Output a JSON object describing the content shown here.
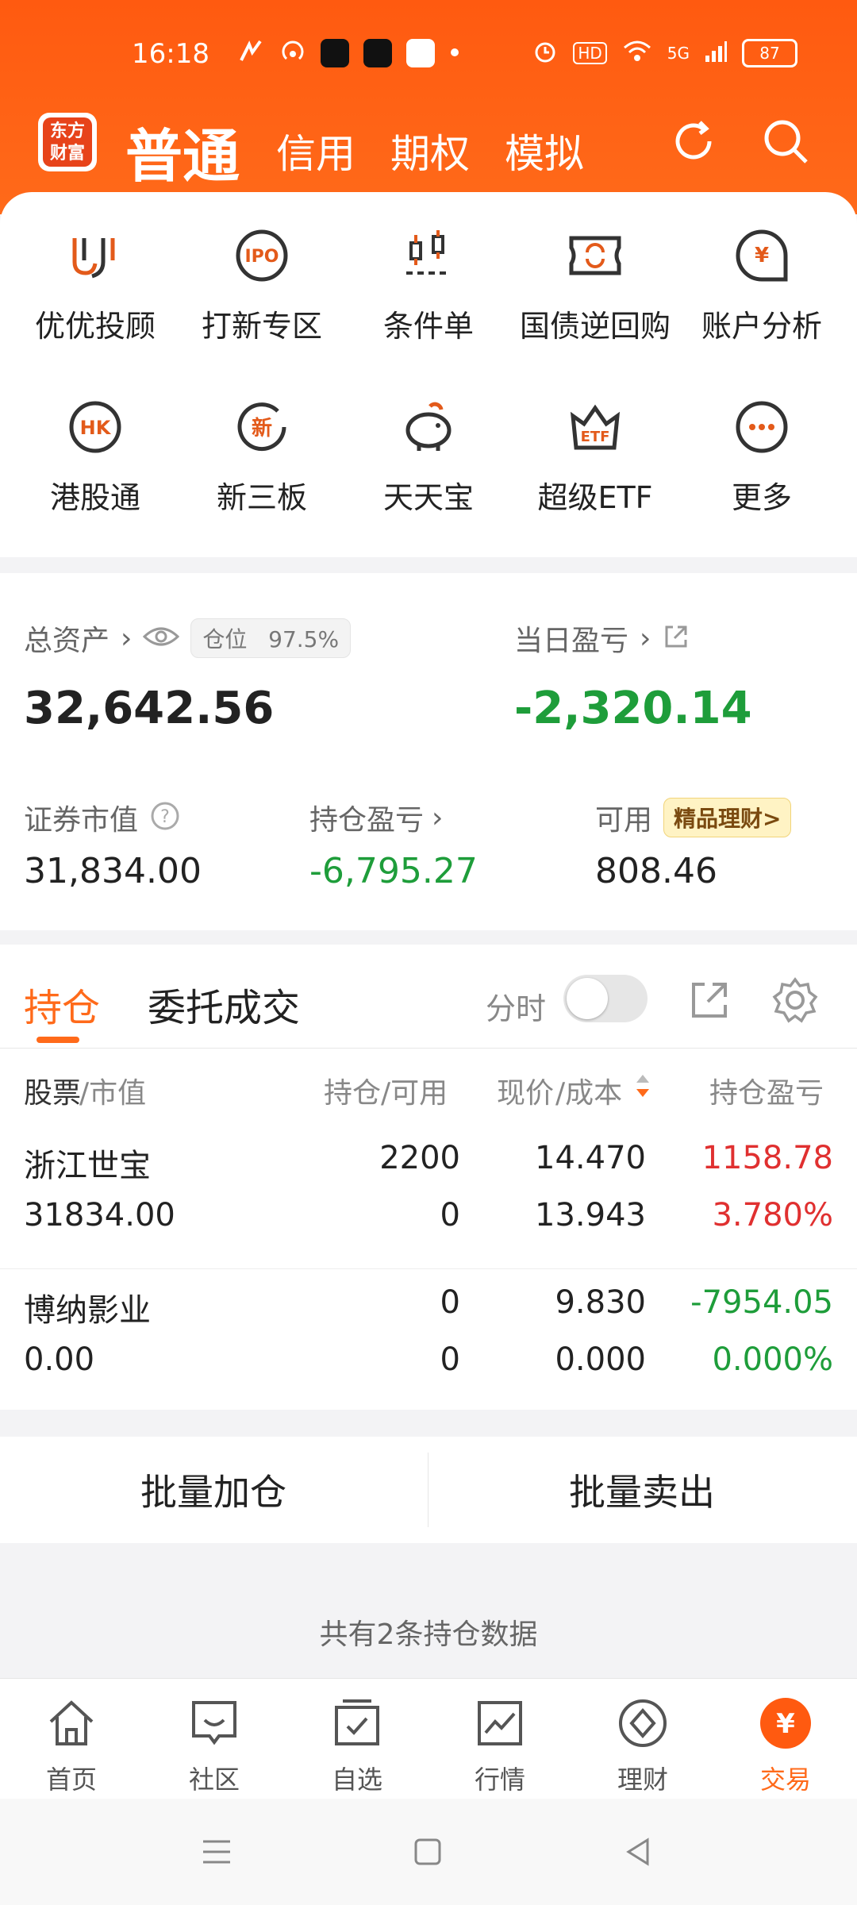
{
  "status_bar": {
    "time": "16:18",
    "hd_label": "HD",
    "network": "5G",
    "battery": "87"
  },
  "header": {
    "logo_text": "东方\n财富",
    "tabs": [
      "普通",
      "信用",
      "期权",
      "模拟"
    ],
    "active_tab": "普通"
  },
  "quick_menu": [
    {
      "label": "优优投顾",
      "icon": "uu-advisor-icon"
    },
    {
      "label": "打新专区",
      "icon": "ipo-icon"
    },
    {
      "label": "条件单",
      "icon": "condition-order-icon"
    },
    {
      "label": "国债逆回购",
      "icon": "reverse-repo-icon"
    },
    {
      "label": "账户分析",
      "icon": "account-analysis-icon"
    },
    {
      "label": "港股通",
      "icon": "hk-connect-icon"
    },
    {
      "label": "新三板",
      "icon": "neeq-icon"
    },
    {
      "label": "天天宝",
      "icon": "piggy-bank-icon"
    },
    {
      "label": "超级ETF",
      "icon": "etf-icon"
    },
    {
      "label": "更多",
      "icon": "more-icon"
    }
  ],
  "assets": {
    "total_label": "总资产",
    "position_label": "仓位",
    "position_value": "97.5%",
    "total_value": "32,642.56",
    "daily_pnl_label": "当日盈亏",
    "daily_pnl_value": "-2,320.14",
    "market_value_label": "证券市值",
    "market_value": "31,834.00",
    "holding_pnl_label": "持仓盈亏",
    "holding_pnl_value": "-6,795.27",
    "available_label": "可用",
    "available_value": "808.46",
    "wealth_badge": "精品理财>"
  },
  "holdings": {
    "tabs": [
      "持仓",
      "委托成交"
    ],
    "active_tab": "持仓",
    "timeshare_label": "分时",
    "timeshare_on": false,
    "columns": {
      "stock": "股票",
      "stock_sub": "/市值",
      "qty": "持仓/可用",
      "price": "现价",
      "price_sub": "/成本",
      "pnl": "持仓盈亏"
    },
    "rows": [
      {
        "name": "浙江世宝",
        "market_value": "31834.00",
        "holding": "2200",
        "available": "0",
        "price": "14.470",
        "cost": "13.943",
        "pnl": "1158.78",
        "pnl_pct": "3.780%",
        "trend": "up"
      },
      {
        "name": "博纳影业",
        "market_value": "0.00",
        "holding": "0",
        "available": "0",
        "price": "9.830",
        "cost": "0.000",
        "pnl": "-7954.05",
        "pnl_pct": "0.000%",
        "trend": "down"
      }
    ]
  },
  "batch": {
    "add": "批量加仓",
    "sell": "批量卖出"
  },
  "summary": "共有2条持仓数据",
  "bottom_nav": [
    "首页",
    "社区",
    "自选",
    "行情",
    "理财",
    "交易"
  ],
  "bottom_nav_active": "交易",
  "colors": {
    "brand": "#ff6a1a",
    "up": "#e03030",
    "down": "#1e9d3a"
  }
}
